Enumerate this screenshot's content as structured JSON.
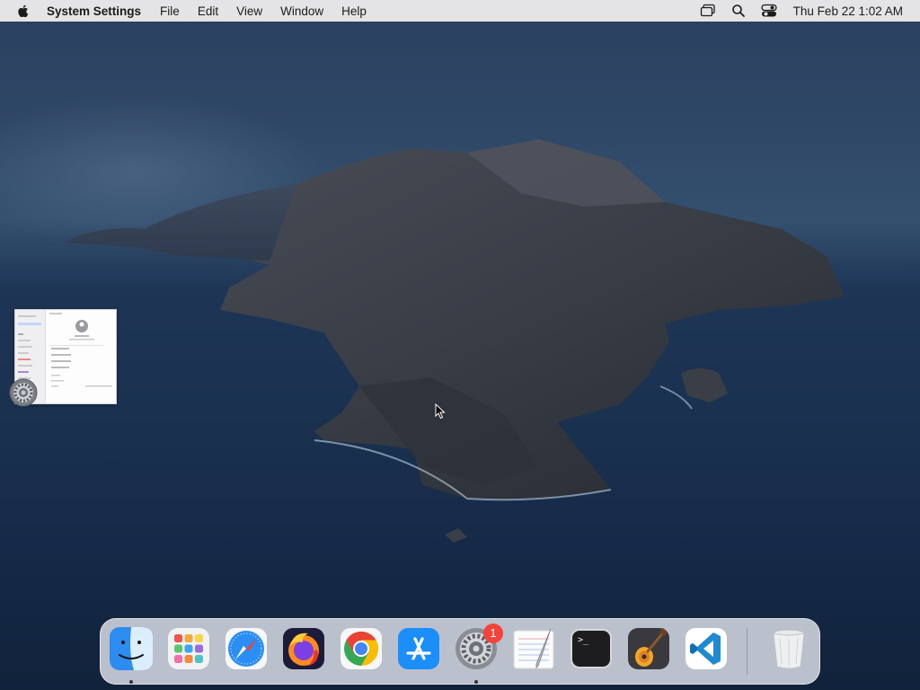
{
  "menubar": {
    "app_name": "System Settings",
    "menus": [
      "File",
      "Edit",
      "View",
      "Window",
      "Help"
    ],
    "status_icons": [
      "screen-mirroring-icon",
      "search-icon",
      "control-center-icon"
    ],
    "clock": "Thu Feb 22  1:02 AM"
  },
  "desktop": {
    "window_thumbnail": {
      "app": "System Settings",
      "icon": "gear-icon"
    }
  },
  "dock": {
    "items": [
      {
        "name": "Finder",
        "icon": "finder-icon",
        "running": true
      },
      {
        "name": "Launchpad",
        "icon": "launchpad-icon",
        "running": false
      },
      {
        "name": "Safari",
        "icon": "safari-icon",
        "running": false
      },
      {
        "name": "Firefox",
        "icon": "firefox-icon",
        "running": false
      },
      {
        "name": "Google Chrome",
        "icon": "chrome-icon",
        "running": false
      },
      {
        "name": "App Store",
        "icon": "app-store-icon",
        "running": false
      },
      {
        "name": "System Settings",
        "icon": "gear-icon",
        "running": true,
        "badge": "1"
      },
      {
        "name": "TextEdit",
        "icon": "textedit-icon",
        "running": false
      },
      {
        "name": "Terminal",
        "icon": "terminal-icon",
        "running": false
      },
      {
        "name": "GarageBand",
        "icon": "guitar-icon",
        "running": false
      },
      {
        "name": "Visual Studio Code",
        "icon": "vscode-icon",
        "running": false
      },
      {
        "name": "Trash",
        "icon": "trash-icon",
        "running": false
      }
    ],
    "terminal_prompt": ">_"
  }
}
